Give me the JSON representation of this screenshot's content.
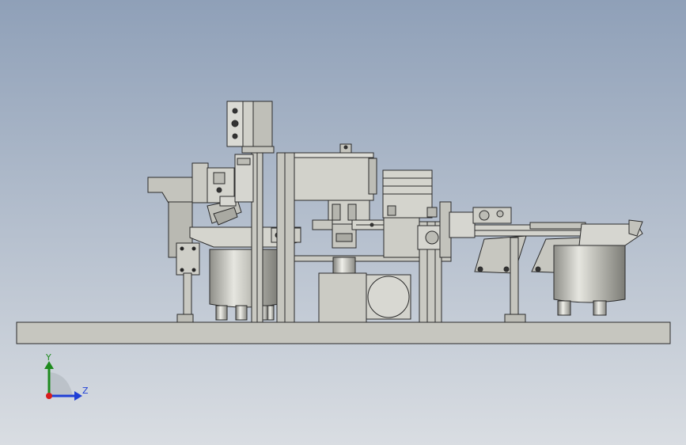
{
  "viewport": {
    "background_top": "#8fa0b8",
    "background_bottom": "#d9dde2",
    "model_fill": "#c9c9c2",
    "model_fill_light": "#dcdcd6",
    "model_fill_dark": "#a9a9a2",
    "edge_color": "#2b2b2b"
  },
  "triad": {
    "y_label": "Y",
    "z_label": "Z",
    "y_color": "#1e8a1e",
    "z_color": "#1f3fd6",
    "x_color": "#d81c1c"
  }
}
